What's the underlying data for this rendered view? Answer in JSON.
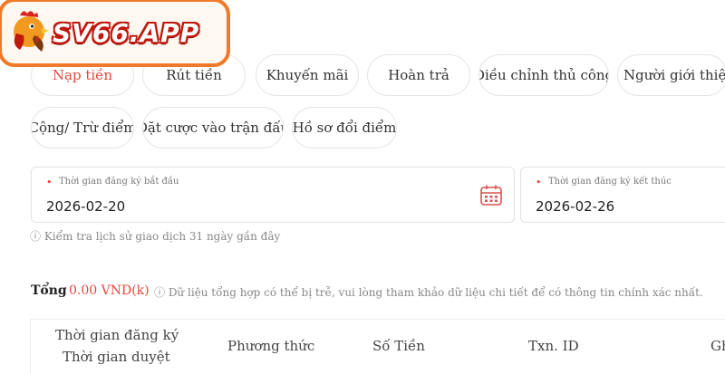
{
  "logo": {
    "text": "SV66.APP"
  },
  "tabs": [
    {
      "label": "Nạp tiền",
      "active": true
    },
    {
      "label": "Rút tiền"
    },
    {
      "label": "Khuyến mãi"
    },
    {
      "label": "Hoàn trả"
    },
    {
      "label": "Điều chỉnh thủ công"
    },
    {
      "label": "Người giới thiệu"
    },
    {
      "label": "Cộng/ Trừ điểm"
    },
    {
      "label": "Đặt cược vào trận đấu"
    },
    {
      "label": "Hồ sơ đổi điểm"
    }
  ],
  "filters": {
    "required_mark": "•",
    "start": {
      "label": "Thời gian đăng ký bắt đầu",
      "value": "2026-02-20",
      "icon": "calendar-icon"
    },
    "end": {
      "label": "Thời gian đăng ký kết thúc",
      "value": "2026-02-26"
    },
    "hint": "ⓘ Kiểm tra lịch sử giao dịch 31 ngày gần đây"
  },
  "summary": {
    "label": "Tổng",
    "amount": "0.00 VND(k)",
    "note": "ⓘ Dữ liệu tổng hợp có thể bị trễ, vui lòng tham khảo dữ liệu chi tiết để có thông tin chính xác nhất."
  },
  "table": {
    "headers": [
      "Thời gian đăng ký",
      "Thời gian duyệt",
      "Phương thức",
      "Số Tiền",
      "Txn. ID",
      "Gh"
    ]
  },
  "colors": {
    "accent": "#e5463b",
    "logo_border": "#f07a2a"
  }
}
